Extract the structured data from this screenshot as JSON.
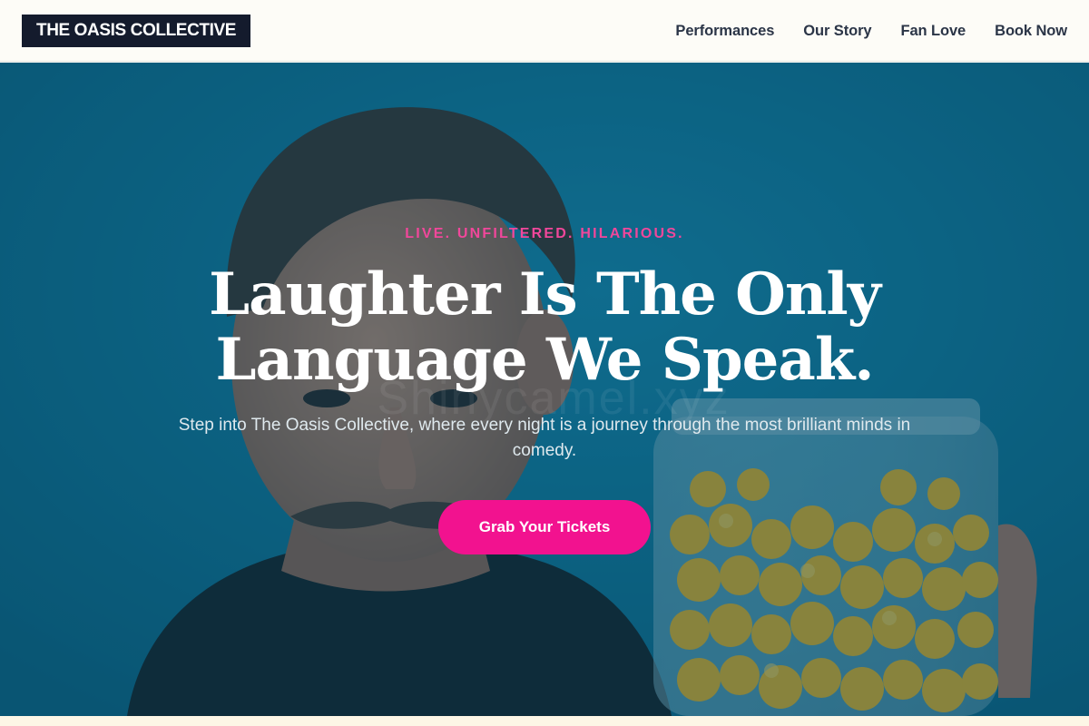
{
  "brand": {
    "logo_text": "THE OASIS COLLECTIVE"
  },
  "nav": {
    "items": [
      {
        "label": "Performances"
      },
      {
        "label": "Our Story"
      },
      {
        "label": "Fan Love"
      },
      {
        "label": "Book Now"
      }
    ]
  },
  "hero": {
    "eyebrow": "LIVE. UNFILTERED. HILARIOUS.",
    "headline_line1": "Laughter Is The Only",
    "headline_line2": "Language We Speak.",
    "subtitle": "Step into The Oasis Collective, where every night is a journey through the most brilliant minds in comedy.",
    "cta_label": "Grab Your Tickets",
    "watermark": "Shinycamel.xyz",
    "background_image": "photo of a mustached man in a black t-shirt beside a glass jar of yellow cheese puffs on a blue background"
  },
  "colors": {
    "accent": "#f2128f",
    "eyebrow": "#f1479b",
    "logo_bg": "#141b2d",
    "hero_bg": "#0e6e8f",
    "nav_text": "#2b3547"
  }
}
